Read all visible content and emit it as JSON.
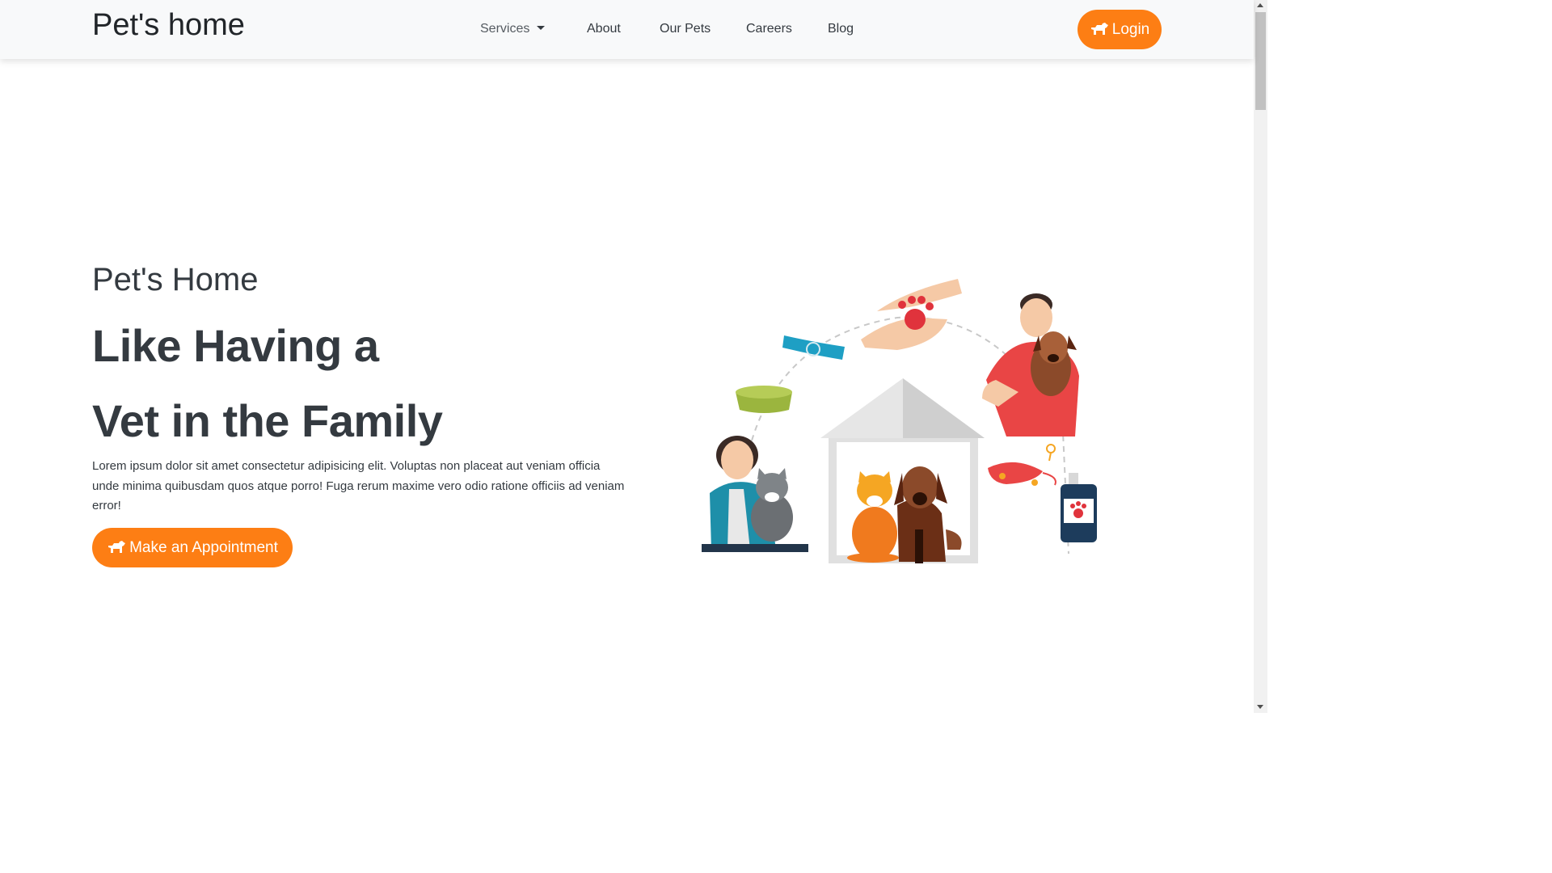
{
  "navbar": {
    "brand": "Pet's home",
    "links": {
      "services": "Services",
      "about": "About",
      "our_pets": "Our Pets",
      "careers": "Careers",
      "blog": "Blog"
    },
    "login_label": "Login"
  },
  "hero": {
    "subtitle": "Pet's Home",
    "heading_line1": "Like Having a",
    "heading_line2": "Vet in the Family",
    "description": "Lorem ipsum dolor sit amet consectetur adipisicing elit. Voluptas non placeat aut veniam officia unde minima quibusdam quos atque porro! Fuga rerum maxime vero odio ratione officiis ad veniam error!",
    "cta_label": "Make an Appointment"
  },
  "colors": {
    "accent": "#fd7e14",
    "navbar_bg": "#f8f9fa",
    "text": "#343a40"
  },
  "icons": {
    "button_icon": "dog-icon",
    "services_dropdown": "caret-down-icon"
  }
}
